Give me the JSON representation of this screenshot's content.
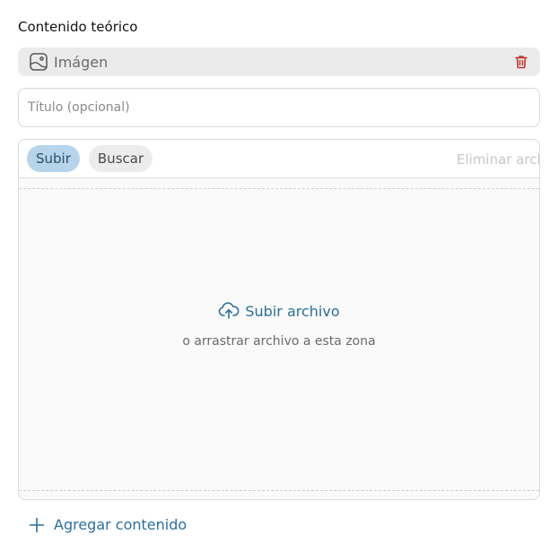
{
  "section": {
    "title": "Contenido teórico"
  },
  "block": {
    "type_label": "Imágen",
    "type_icon": "image-icon",
    "delete_icon": "trash-icon"
  },
  "title_field": {
    "placeholder": "Título (opcional)",
    "value": ""
  },
  "uploader": {
    "tabs": [
      {
        "label": "Subir",
        "active": true
      },
      {
        "label": "Buscar",
        "active": false
      }
    ],
    "remove_label": "Eliminar archivo",
    "upload_label": "Subir archivo",
    "upload_icon": "cloud-upload-icon",
    "hint": "o arrastrar archivo a esta zona"
  },
  "footer": {
    "add_label": "Agregar contenido",
    "add_icon": "plus-icon"
  },
  "colors": {
    "accent": "#2a6f9e",
    "danger": "#c0392b",
    "active_tab_bg": "#b6d4ea"
  }
}
